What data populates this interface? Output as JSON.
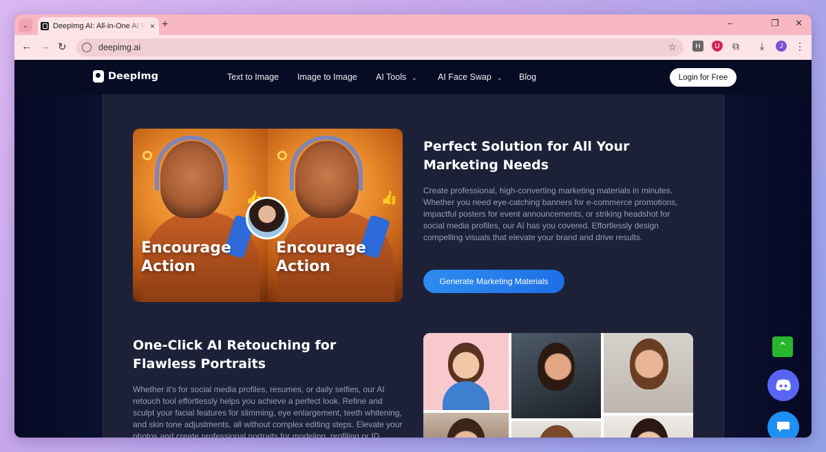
{
  "browser": {
    "tab_title": "DeepImg AI: All-in-One AI Photo",
    "tab_close": "×",
    "new_tab": "+",
    "url": "deepimg.ai",
    "window_controls": [
      "–",
      "❐",
      "✕"
    ],
    "icons": [
      "back-icon",
      "forward-icon",
      "reload-icon",
      "site-info-icon",
      "star-icon",
      "extension-h-icon",
      "extension-shield-icon",
      "extensions-puzzle-icon",
      "download-icon",
      "profile-avatar",
      "menu-icon"
    ],
    "profile_initial": "J",
    "ext_h_label": "H"
  },
  "nav": {
    "logo_text": "DeepImg",
    "links": [
      {
        "label": "Text to Image"
      },
      {
        "label": "Image to Image"
      },
      {
        "label": "AI Tools",
        "dropdown": true
      },
      {
        "label": "AI Face Swap",
        "dropdown": true
      },
      {
        "label": "Blog"
      }
    ],
    "login_label": "Login for Free",
    "chevron": "⌄"
  },
  "marketing": {
    "title": "Perfect Solution for All Your Marketing Needs",
    "description": "Create professional, high-converting marketing materials in minutes. Whether you need eye-catching banners for e-commerce promotions, impactful posters for event announcements, or striking headshot for social media profiles, our AI has you covered. Effortlessly design compelling visuals that elevate your brand and drive results.",
    "cta_label": "Generate Marketing Materials",
    "image_caption_line1": "Encourage",
    "image_caption_line2": "Action"
  },
  "retouch": {
    "title": "One-Click AI Retouching for Flawless Portraits",
    "description": "Whether it's for social media profiles, resumes, or daily selfies, our AI retouch tool effortlessly helps you achieve a perfect look. Refine and sculpt your facial features for slimming, eye enlargement, teeth whitening, and skin tone adjustments, all without complex editing steps. Elevate your photos and create professional portraits for modeling, profiling or ID photos."
  },
  "floating": {
    "up_icon": "⌃",
    "discord_icon": "discord-icon",
    "chat_icon": "chat-icon"
  },
  "colors": {
    "accent": "#2d8cf0",
    "tab_strip": "#f7b7c3",
    "page_bg": "#151a3a",
    "up_button": "#27b72e",
    "discord": "#5865f2"
  }
}
